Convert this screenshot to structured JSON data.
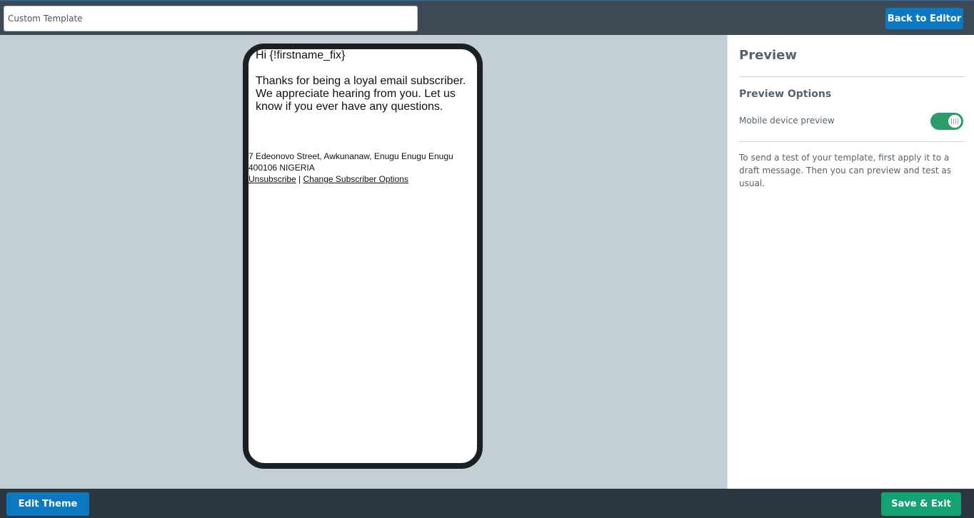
{
  "header": {
    "template_name_value": "Custom Template",
    "back_label": "Back to Editor"
  },
  "email": {
    "greeting": "Hi {!firstname_fix}",
    "body": "Thanks for being a loyal email subscriber. We appreciate hearing from you. Let us know if you ever have any questions.",
    "address_line1": "7 Edeonovo Street, Awkunanaw, Enugu Enugu Enugu",
    "address_line2": "400106 NIGERIA",
    "unsubscribe": "Unsubscribe",
    "separator": "|",
    "change_options": "Change Subscriber Options"
  },
  "sidebar": {
    "title": "Preview",
    "options_heading": "Preview Options",
    "mobile_label": "Mobile device preview",
    "mobile_enabled": true,
    "note": "To send a test of your template, first apply it to a draft message. Then you can preview and test as usual."
  },
  "footer": {
    "edit_theme": "Edit Theme",
    "save_exit": "Save & Exit"
  },
  "colors": {
    "topbar": "#3c4a56",
    "bottombar": "#2b3640",
    "canvas": "#c3ced5",
    "primary_button": "#0b78c2",
    "success_button": "#13a271",
    "toggle_on": "#2a9d6a"
  },
  "icons": {
    "toggle_grip": "grip-icon"
  }
}
